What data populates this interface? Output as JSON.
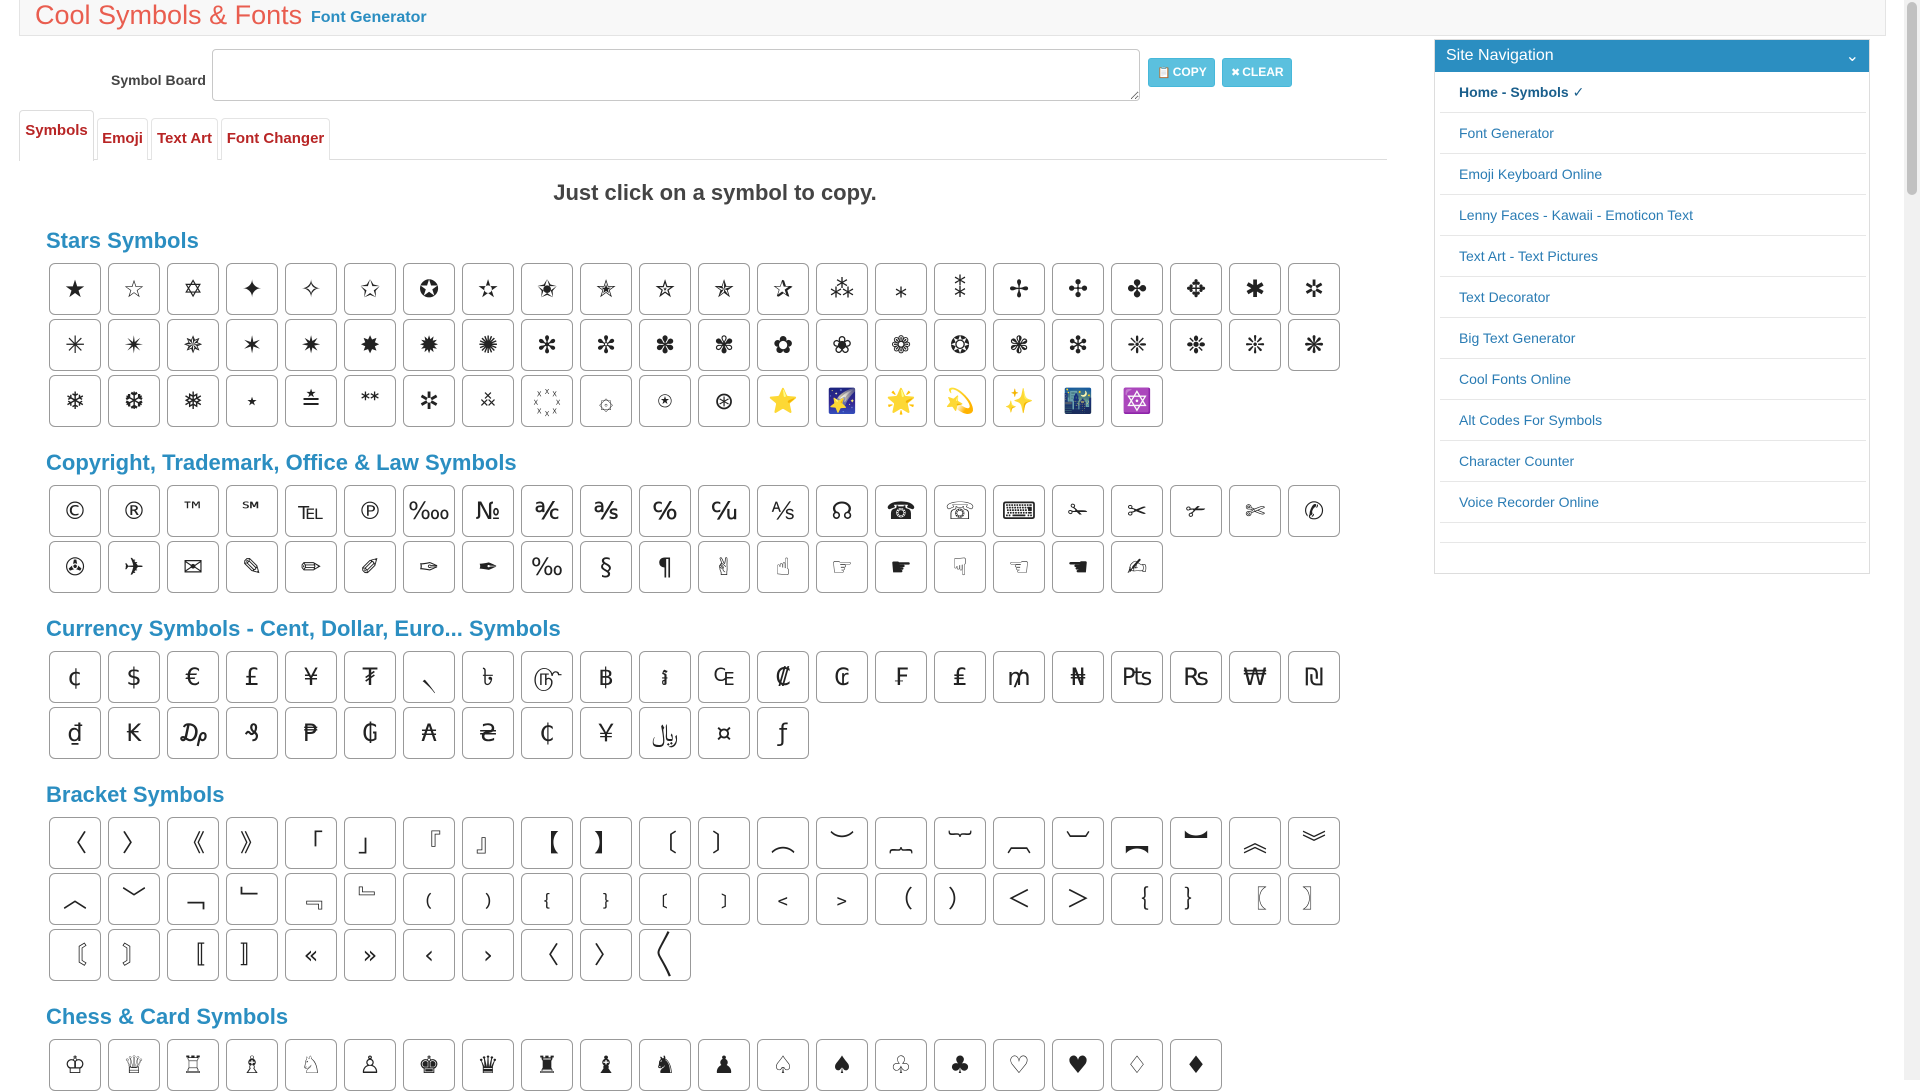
{
  "header": {
    "brand": "Cool Symbols & Fonts",
    "sub": "Font Generator"
  },
  "board": {
    "label": "Symbol Board",
    "value": "",
    "copy": "COPY",
    "clear": "CLEAR",
    "copy_icon": "📋",
    "clear_icon": "✖"
  },
  "tabs": [
    "Symbols",
    "Emoji",
    "Text Art",
    "Font Changer"
  ],
  "instruction": "Just click on a symbol to copy.",
  "sections": [
    {
      "title": "Stars Symbols",
      "symbols": [
        "★",
        "☆",
        "✡",
        "✦",
        "✧",
        "✩",
        "✪",
        "✫",
        "✬",
        "✭",
        "✮",
        "✯",
        "✰",
        "⁂",
        "⁎",
        "⁑",
        "✢",
        "✣",
        "✤",
        "✥",
        "✱",
        "✲",
        "✳",
        "✴",
        "✵",
        "✶",
        "✷",
        "✸",
        "✹",
        "✺",
        "✻",
        "✼",
        "✽",
        "✾",
        "✿",
        "❀",
        "❁",
        "❂",
        "❃",
        "❇",
        "❈",
        "❉",
        "❊",
        "❋",
        "❄",
        "❆",
        "❅",
        "⋆",
        "≛",
        "ᕯ",
        "✲",
        "࿏",
        "꙰",
        "۞",
        "⍟",
        "⊛",
        "⭐",
        "🌠",
        "🌟",
        "💫",
        "✨",
        "🌃",
        "🔯"
      ]
    },
    {
      "title": "Copyright, Trademark, Office & Law Symbols",
      "symbols": [
        "©",
        "®",
        "™",
        "℠",
        "℡",
        "℗",
        "‱",
        "№",
        "℀",
        "℁",
        "℅",
        "℆",
        "⅍",
        "☊",
        "☎",
        "☏",
        "⌨",
        "✁",
        "✂",
        "✃",
        "✄",
        "✆",
        "✇",
        "✈",
        "✉",
        "✎",
        "✏",
        "✐",
        "✑",
        "✒",
        "‰",
        "§",
        "¶",
        "✌",
        "☝",
        "☞",
        "☛",
        "☟",
        "☜",
        "☚",
        "✍"
      ]
    },
    {
      "title": "Currency Symbols - Cent, Dollar, Euro... Symbols",
      "symbols": [
        "¢",
        "$",
        "€",
        "£",
        "¥",
        "₮",
        "৲",
        "৳",
        "௹",
        "฿",
        "៛",
        "₠",
        "₡",
        "₢",
        "₣",
        "₤",
        "₥",
        "₦",
        "₧",
        "₨",
        "₩",
        "₪",
        "₫",
        "₭",
        "₯",
        "₰",
        "₱",
        "₲",
        "₳",
        "₴",
        "₵",
        "￥",
        "﷼",
        "¤",
        "ƒ"
      ]
    },
    {
      "title": "Bracket Symbols",
      "symbols": [
        "〈",
        "〉",
        "《",
        "》",
        "「",
        "」",
        "『",
        "』",
        "【",
        "】",
        "〔",
        "〕",
        "︵",
        "︶",
        "︷",
        "︸",
        "︹",
        "︺",
        "︻",
        "︼",
        "︽",
        "︾",
        "︿",
        "﹀",
        "﹁",
        "﹂",
        "﹃",
        "﹄",
        "﹙",
        "﹚",
        "﹛",
        "﹜",
        "﹝",
        "﹞",
        "﹤",
        "﹥",
        "（",
        "）",
        "＜",
        "＞",
        "｛",
        "｝",
        "〖",
        "〗",
        "〘",
        "〙",
        "〚",
        "〛",
        "«",
        "»",
        "‹",
        "›",
        "〈",
        "〉",
        "〱"
      ]
    },
    {
      "title": "Chess & Card Symbols",
      "symbols": [
        "♔",
        "♕",
        "♖",
        "♗",
        "♘",
        "♙",
        "♚",
        "♛",
        "♜",
        "♝",
        "♞",
        "♟",
        "♤",
        "♠",
        "♧",
        "♣",
        "♡",
        "♥",
        "♢",
        "♦"
      ]
    }
  ],
  "nav": {
    "title": "Site Navigation",
    "chevron": "⌄",
    "items": [
      "Home - Symbols ✓",
      "Font Generator",
      "Emoji Keyboard Online",
      "Lenny Faces - Kawaii - Emoticon Text",
      "Text Art - Text Pictures",
      "Text Decorator",
      "Big Text Generator",
      "Cool Fonts Online",
      "Alt Codes For Symbols",
      "Character Counter",
      "Voice Recorder Online"
    ]
  }
}
